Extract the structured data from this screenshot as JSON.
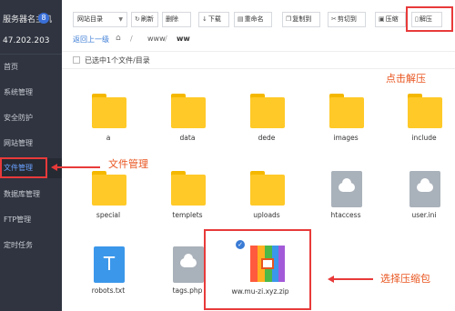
{
  "sidebar": {
    "brand": "服务器名主机",
    "badge": "8",
    "ip": "47.202.203",
    "items": [
      {
        "label": "首页"
      },
      {
        "label": "系统管理"
      },
      {
        "label": "安全防护"
      },
      {
        "label": "网站管理"
      },
      {
        "label": "文件管理"
      },
      {
        "label": "数据库管理"
      },
      {
        "label": "FTP管理"
      },
      {
        "label": "定时任务"
      }
    ]
  },
  "toolbar": {
    "select_label": "网站目录",
    "buttons": [
      {
        "label": "刷新",
        "icon": "refresh-icon"
      },
      {
        "label": "删除",
        "icon": "delete-icon"
      },
      {
        "label": "下载",
        "icon": "download-icon"
      },
      {
        "label": "重命名",
        "icon": "rename-icon"
      },
      {
        "label": "复制到",
        "icon": "copy-icon"
      },
      {
        "label": "剪切到",
        "icon": "cut-icon"
      },
      {
        "label": "压缩",
        "icon": "compress-icon"
      },
      {
        "label": "解压",
        "icon": "extract-icon"
      }
    ]
  },
  "breadcrumb": {
    "up": "返回上一级",
    "sep": "/",
    "path1": "www",
    "path2": "ww"
  },
  "selection": {
    "text": "已选中1个文件/目录"
  },
  "files": [
    {
      "name": "a",
      "type": "folder"
    },
    {
      "name": "data",
      "type": "folder"
    },
    {
      "name": "dede",
      "type": "folder"
    },
    {
      "name": "images",
      "type": "folder"
    },
    {
      "name": "include",
      "type": "folder"
    },
    {
      "name": "special",
      "type": "folder"
    },
    {
      "name": "templets",
      "type": "folder"
    },
    {
      "name": "uploads",
      "type": "folder"
    },
    {
      "name": "htaccess",
      "type": "file"
    },
    {
      "name": "user.ini",
      "type": "file"
    },
    {
      "name": "robots.txt",
      "type": "text"
    },
    {
      "name": "tags.php",
      "type": "file"
    },
    {
      "name": "ww.mu-zi.xyz.zip",
      "type": "zip"
    }
  ],
  "annotations": {
    "extract": "点击解压",
    "file_manager": "文件管理",
    "select_zip": "选择压缩包"
  },
  "colors": {
    "highlight": "#e83a3a",
    "annotation": "#e8541e",
    "folder": "#ffc928",
    "sidebar": "#2f3440"
  }
}
